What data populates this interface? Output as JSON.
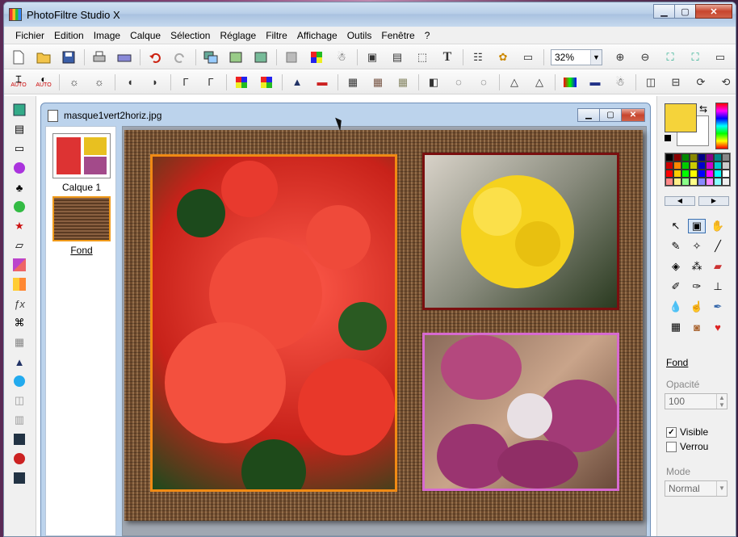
{
  "app": {
    "title": "PhotoFiltre Studio X",
    "window_buttons": {
      "minimize": "▁",
      "maximize": "▢",
      "close": "✕"
    }
  },
  "menubar": [
    "Fichier",
    "Edition",
    "Image",
    "Calque",
    "Sélection",
    "Réglage",
    "Filtre",
    "Affichage",
    "Outils",
    "Fenêtre",
    "?"
  ],
  "toolbar1": {
    "icons": [
      "new-icon",
      "open-icon",
      "save-icon",
      "print-icon",
      "scan-icon",
      "undo-icon",
      "redo-icon",
      "copy-layer-icon",
      "paste-layer-icon",
      "image-icon",
      "grey-square-icon",
      "color-grid-icon",
      "figure-icon",
      "adjust-icon",
      "adjust2-icon",
      "crop-icon",
      "text-icon",
      "layers-icon",
      "plugin-icon",
      "window-icon"
    ],
    "zoom": "32%",
    "zoom_icons": [
      "zoom-in-icon",
      "zoom-out-icon",
      "fit-icon",
      "fullscreen-icon",
      "monitor-icon"
    ]
  },
  "toolbar2": {
    "labels": {
      "auto1": "AUTO",
      "auto2": "AUTO"
    }
  },
  "document": {
    "filename": "masque1vert2horiz.jpg",
    "layers": [
      {
        "name": "Calque 1"
      },
      {
        "name": "Fond"
      }
    ]
  },
  "right_panel": {
    "fg_color": "#f5d33a",
    "layer_name": "Fond",
    "opacity_label": "Opacité",
    "opacity_value": "100",
    "visible_label": "Visible",
    "visible_checked": true,
    "lock_label": "Verrou",
    "lock_checked": false,
    "mode_label": "Mode",
    "mode_value": "Normal"
  },
  "colors": {
    "border_orange": "#f08a14",
    "border_maroon": "#7a0f0f",
    "border_pink": "#d76ad0",
    "weave": "#7b5535"
  }
}
